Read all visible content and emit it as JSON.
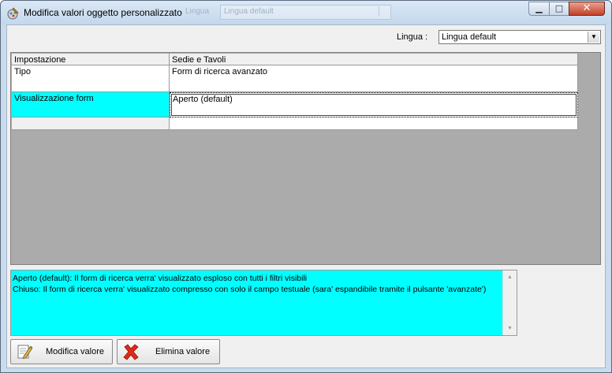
{
  "window": {
    "title": "Modifica valori oggetto personalizzato"
  },
  "background_window": {
    "label": "Lingua",
    "select_value": "Lingua default"
  },
  "language": {
    "label": "Lingua :",
    "selected": "Lingua default"
  },
  "grid": {
    "columns": [
      "Impostazione",
      "Sedie e Tavoli"
    ],
    "rows": [
      {
        "setting": "Tipo",
        "value": "Form di ricerca avanzato"
      },
      {
        "setting": "Visualizzazione form",
        "value": "Aperto (default)"
      },
      {
        "setting": "",
        "value": ""
      }
    ]
  },
  "description": {
    "lines": [
      "Aperto (default): Il form di ricerca verra' visualizzato esploso con tutti i filtri visibili",
      "Chiuso: Il form di ricerca verra' visualizzato compresso con solo il campo testuale (sara' espandibile tramite il pulsante 'avanzate')"
    ]
  },
  "buttons": {
    "modify": "Modifica valore",
    "delete": "Elimina valore"
  },
  "colors": {
    "selection": "#00ffff",
    "grid_background": "#ababab",
    "title_bar": "#c9dced",
    "close_button": "#c4412a"
  }
}
